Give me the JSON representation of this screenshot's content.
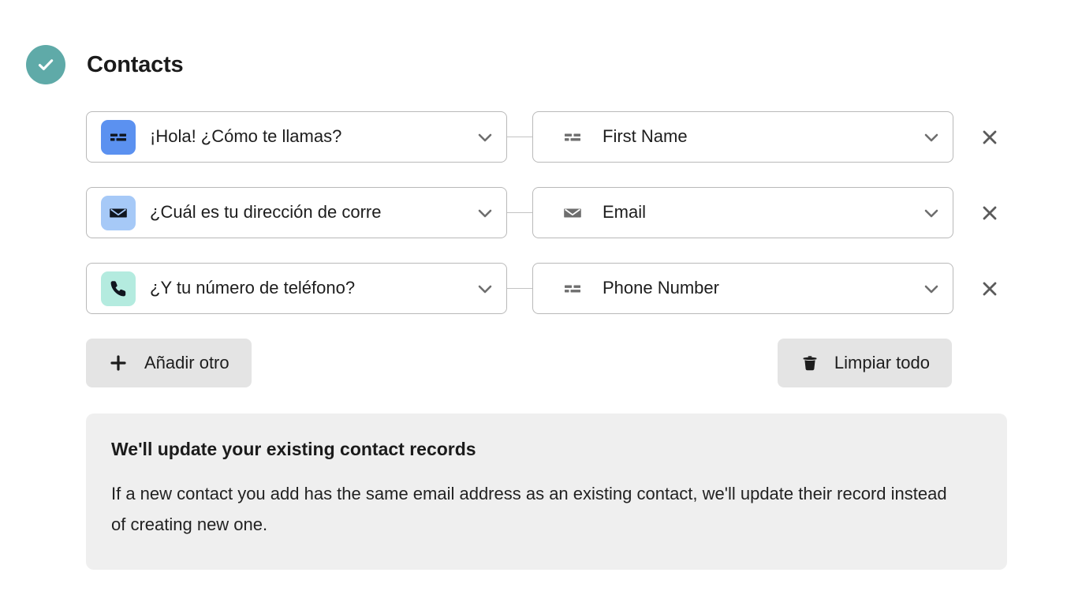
{
  "header": {
    "title": "Contacts",
    "status_icon": "check-circle-icon",
    "status_color": "#5faaa8"
  },
  "rows": [
    {
      "source": {
        "label": "¡Hola! ¿Cómo te llamas?",
        "icon": "short-text-icon",
        "icon_bg": "#5b91f0",
        "icon_fg": "#10161f"
      },
      "target": {
        "label": "First Name",
        "icon": "short-text-icon",
        "icon_fg": "#6e6e6e"
      },
      "remove_icon": "close-icon"
    },
    {
      "source": {
        "label": "¿Cuál es tu dirección de corre",
        "icon": "email-icon",
        "icon_bg": "#a6c9f7",
        "icon_fg": "#10161f"
      },
      "target": {
        "label": "Email",
        "icon": "email-icon",
        "icon_fg": "#6e6e6e"
      },
      "remove_icon": "close-icon"
    },
    {
      "source": {
        "label": "¿Y tu número de teléfono?",
        "icon": "phone-icon",
        "icon_bg": "#b4ebdf",
        "icon_fg": "#10161f"
      },
      "target": {
        "label": "Phone Number",
        "icon": "short-text-icon",
        "icon_fg": "#6e6e6e"
      },
      "remove_icon": "close-icon"
    }
  ],
  "actions": {
    "add": {
      "label": "Añadir otro",
      "icon": "plus-icon"
    },
    "clear": {
      "label": "Limpiar todo",
      "icon": "trash-icon"
    }
  },
  "info": {
    "title": "We'll update your existing contact records",
    "body": "If a new contact you add has the same email address as an existing contact, we'll update their record instead of creating new one."
  }
}
